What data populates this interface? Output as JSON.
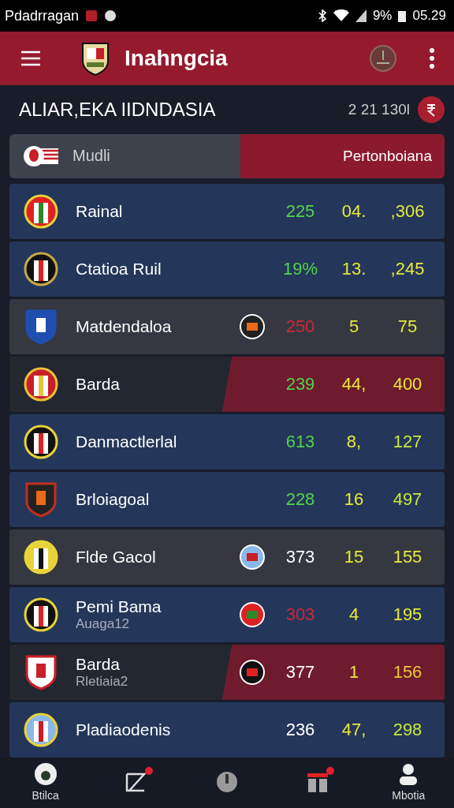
{
  "status_bar": {
    "carrier": "Pdadrragan",
    "battery": "9%",
    "time": "05.29"
  },
  "app_bar": {
    "title": "Inahngcia"
  },
  "section": {
    "title": "ALIAR,EKA IIDNDASIA",
    "count": "2 21 130l"
  },
  "table_header": {
    "left": "Mudli",
    "right": "Pertonboiana"
  },
  "rows": [
    {
      "kind": "blue",
      "name": "Rainal",
      "badge": false,
      "stats": [
        {
          "text": "225",
          "color": "#4fd34a"
        },
        {
          "text": "04.",
          "color": "#e8e83a"
        },
        {
          "text": ",306",
          "color": "#e8e83a"
        }
      ]
    },
    {
      "kind": "blue",
      "name": "Ctatioa Ruil",
      "badge": false,
      "stats": [
        {
          "text": "19%",
          "color": "#4fd34a"
        },
        {
          "text": "13.",
          "color": "#e8e83a"
        },
        {
          "text": ",245",
          "color": "#e8e83a"
        }
      ]
    },
    {
      "kind": "grey",
      "name": "Matdendaloa",
      "badge": true,
      "stats": [
        {
          "text": "250",
          "color": "#d0253a"
        },
        {
          "text": "5",
          "color": "#e8e83a"
        },
        {
          "text": "75",
          "color": "#e8e83a"
        }
      ]
    },
    {
      "kind": "split",
      "name": "Barda",
      "badge": false,
      "stats": [
        {
          "text": "239",
          "color": "#4fd34a"
        },
        {
          "text": "44,",
          "color": "#e8e83a"
        },
        {
          "text": "400",
          "color": "#e8e83a"
        }
      ]
    },
    {
      "kind": "blue",
      "name": "Danmactlerlal",
      "badge": false,
      "stats": [
        {
          "text": "613",
          "color": "#4fd34a"
        },
        {
          "text": "8,",
          "color": "#e8e83a"
        },
        {
          "text": "127",
          "color": "#c8e83a"
        }
      ]
    },
    {
      "kind": "blue",
      "name": "Brloiagoal",
      "badge": false,
      "stats": [
        {
          "text": "228",
          "color": "#4fd34a"
        },
        {
          "text": "16",
          "color": "#e8e83a"
        },
        {
          "text": "497",
          "color": "#c8e83a"
        }
      ]
    },
    {
      "kind": "grey",
      "name": "Flde Gacol",
      "badge": true,
      "stats": [
        {
          "text": "373",
          "color": "#ffffff"
        },
        {
          "text": "15",
          "color": "#e8e83a"
        },
        {
          "text": "155",
          "color": "#e8e83a"
        }
      ]
    },
    {
      "kind": "blue",
      "name": "Pemi Bama",
      "subtitle": "Auaga12",
      "badge": true,
      "stats": [
        {
          "text": "303",
          "color": "#d0253a"
        },
        {
          "text": "4",
          "color": "#e8e83a"
        },
        {
          "text": "195",
          "color": "#e8e83a"
        }
      ]
    },
    {
      "kind": "split",
      "name": "Barda",
      "subtitle": "Rletiaia2",
      "badge": true,
      "stats": [
        {
          "text": "377",
          "color": "#ffffff"
        },
        {
          "text": "1",
          "color": "#e8e83a"
        },
        {
          "text": "156",
          "color": "#e8c83a"
        }
      ]
    },
    {
      "kind": "blue",
      "name": "Pladiaodenis",
      "badge": false,
      "stats": [
        {
          "text": "236",
          "color": "#ffffff"
        },
        {
          "text": "47,",
          "color": "#e8e83a"
        },
        {
          "text": "298",
          "color": "#c8e83a"
        }
      ]
    }
  ],
  "bottom_nav": [
    {
      "label": "Btilca",
      "notify": false
    },
    {
      "notify": true
    },
    {
      "notify": false
    },
    {
      "notify": true
    },
    {
      "label": "Mbotia",
      "notify": false
    }
  ]
}
